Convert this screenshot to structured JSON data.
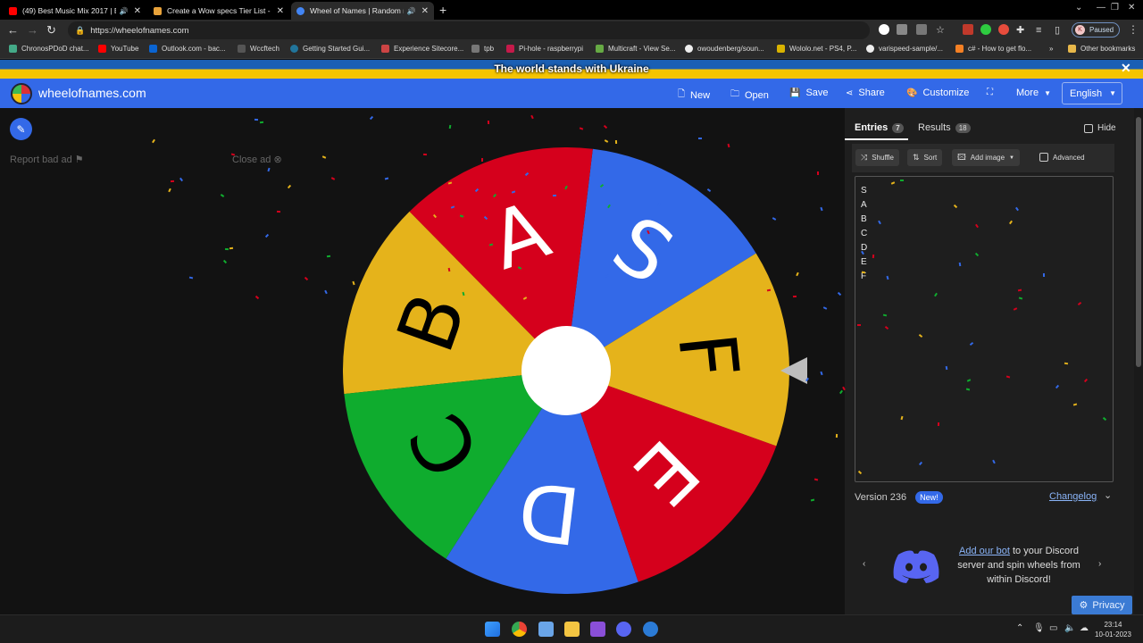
{
  "browser": {
    "tabs": [
      {
        "title": "(49) Best Music Mix 2017 | B",
        "favicon_color": "#ff0000",
        "active": false
      },
      {
        "title": "Create a Wow specs Tier List - Ti",
        "favicon_color": "#e8a23a",
        "active": false
      },
      {
        "title": "Wheel of Names | Random n",
        "favicon_color": "#4285f4",
        "active": true
      }
    ],
    "url": "https://wheelofnames.com",
    "profile_initial": "K",
    "profile_status": "Paused",
    "bookmarks": [
      "ChronosPDoD chat...",
      "YouTube",
      "Outlook.com - bac...",
      "Wccftech",
      "Getting Started Gui...",
      "Experience Sitecore...",
      "tpb",
      "Pi-hole - raspberrypi",
      "Multicraft - View Se...",
      "owoudenberg/soun...",
      "Wololo.net - PS4, P...",
      "varispeed-sample/...",
      "c# - How to get flo...",
      "Other bookmarks"
    ]
  },
  "banner": {
    "text": "The world stands with Ukraine"
  },
  "header": {
    "brand": "wheelofnames.com",
    "buttons": {
      "new": "New",
      "open": "Open",
      "save": "Save",
      "share": "Share",
      "customize": "Customize",
      "more": "More"
    },
    "language": "English"
  },
  "ad": {
    "report": "Report bad ad",
    "close": "Close ad"
  },
  "wheel": {
    "segments": [
      {
        "label": "S",
        "color": "#3369e8",
        "text_color": "#ffffff"
      },
      {
        "label": "A",
        "color": "#d5001c",
        "text_color": "#ffffff"
      },
      {
        "label": "B",
        "color": "#e5b31b",
        "text_color": "#000000"
      },
      {
        "label": "C",
        "color": "#0fac2e",
        "text_color": "#000000"
      },
      {
        "label": "D",
        "color": "#3369e8",
        "text_color": "#ffffff"
      },
      {
        "label": "E",
        "color": "#d5001c",
        "text_color": "#ffffff"
      },
      {
        "label": "F",
        "color": "#e5b31b",
        "text_color": "#000000"
      }
    ]
  },
  "panel": {
    "tabs": {
      "entries": "Entries",
      "entries_count": "7",
      "results": "Results",
      "results_count": "18"
    },
    "hide": "Hide",
    "tools": {
      "shuffle": "Shuffle",
      "sort": "Sort",
      "add_image": "Add image",
      "advanced": "Advanced"
    },
    "entries": [
      "S",
      "A",
      "B",
      "C",
      "D",
      "E",
      "F"
    ],
    "version": "Version 236",
    "new_badge": "New!",
    "changelog": "Changelog",
    "discord": {
      "link": "Add our bot",
      "line1": "to your Discord",
      "line2": "server and spin wheels from",
      "line3": "within Discord!"
    },
    "privacy": "Privacy"
  },
  "taskbar": {
    "time": "23:14",
    "date": "10-01-2023"
  }
}
